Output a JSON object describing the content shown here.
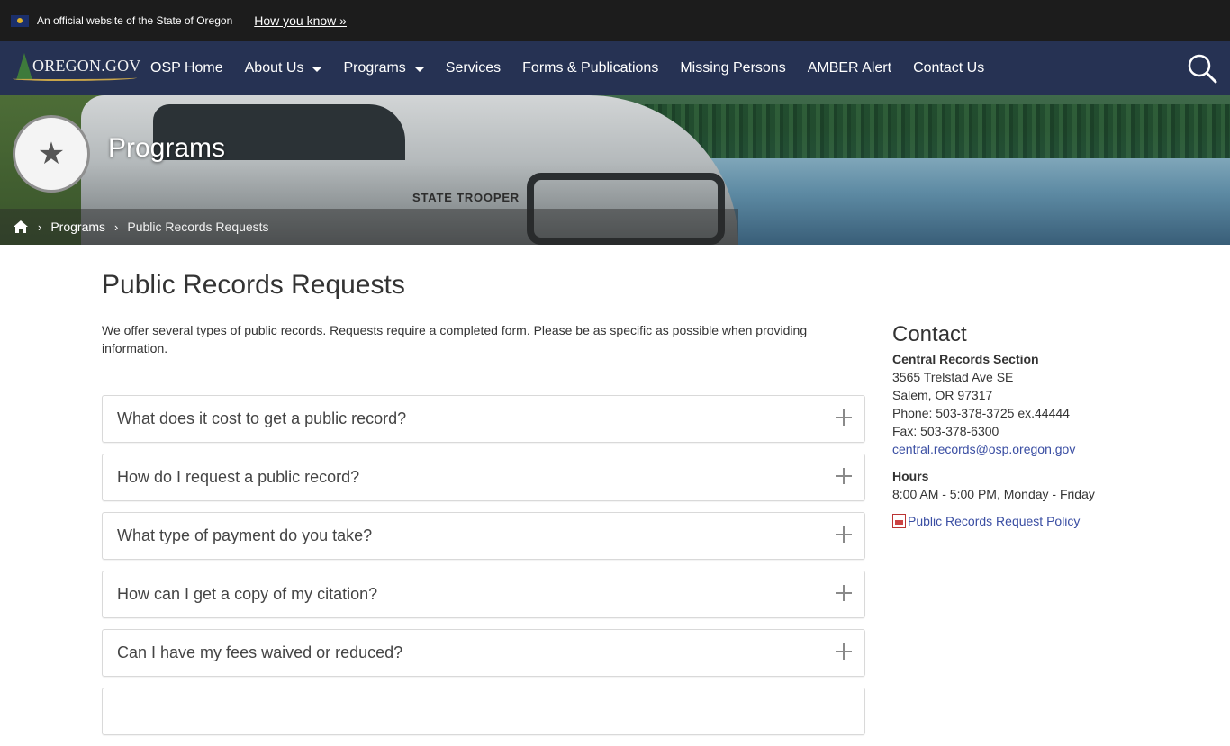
{
  "gov_banner": {
    "text": "An official website of the State of Oregon",
    "link": "How you know »"
  },
  "navbar": {
    "logo": "OREGON.GOV",
    "items": [
      {
        "label": "OSP Home",
        "dropdown": false
      },
      {
        "label": "About Us",
        "dropdown": true
      },
      {
        "label": "Programs",
        "dropdown": true
      },
      {
        "label": "Services",
        "dropdown": false
      },
      {
        "label": "Forms & Publications",
        "dropdown": false
      },
      {
        "label": "Missing Persons",
        "dropdown": false
      },
      {
        "label": "AMBER Alert",
        "dropdown": false
      },
      {
        "label": "Contact Us",
        "dropdown": false
      }
    ],
    "search_icon": "search-icon"
  },
  "hero": {
    "title": "Programs",
    "truck_text": "STATE TROOPER",
    "breadcrumb": {
      "home_icon": "home-icon",
      "link": "Programs",
      "current": "Public Records Requests"
    }
  },
  "main": {
    "title": "Public Records Requests",
    "intro": "We offer several types of public records.  Requests require a completed form. Please be as specific as possible when providing information.",
    "faq": [
      "What does it cost to get a public record?",
      "How do I request a public record?",
      "What type of payment do you take?",
      "How can I get a copy of my citation?",
      "Can I have my fees waived or reduced?"
    ]
  },
  "sidebar": {
    "title": "Contact",
    "org": "Central Records Section",
    "address1": "3565 Trelstad Ave SE",
    "address2": "Salem, OR 97317",
    "phone": "Phone: 503-378-3725 ex.44444",
    "fax": "Fax: 503-378-6300",
    "email": "central.records@osp.oregon.gov",
    "hours_title": "Hours",
    "hours": "8:00 AM - 5:00 PM, Monday - Friday",
    "policy_link": "Public Records Request Policy"
  },
  "colors": {
    "banner_bg": "#1c1c1c",
    "nav_bg": "#263253",
    "link": "#3a4ea3"
  }
}
